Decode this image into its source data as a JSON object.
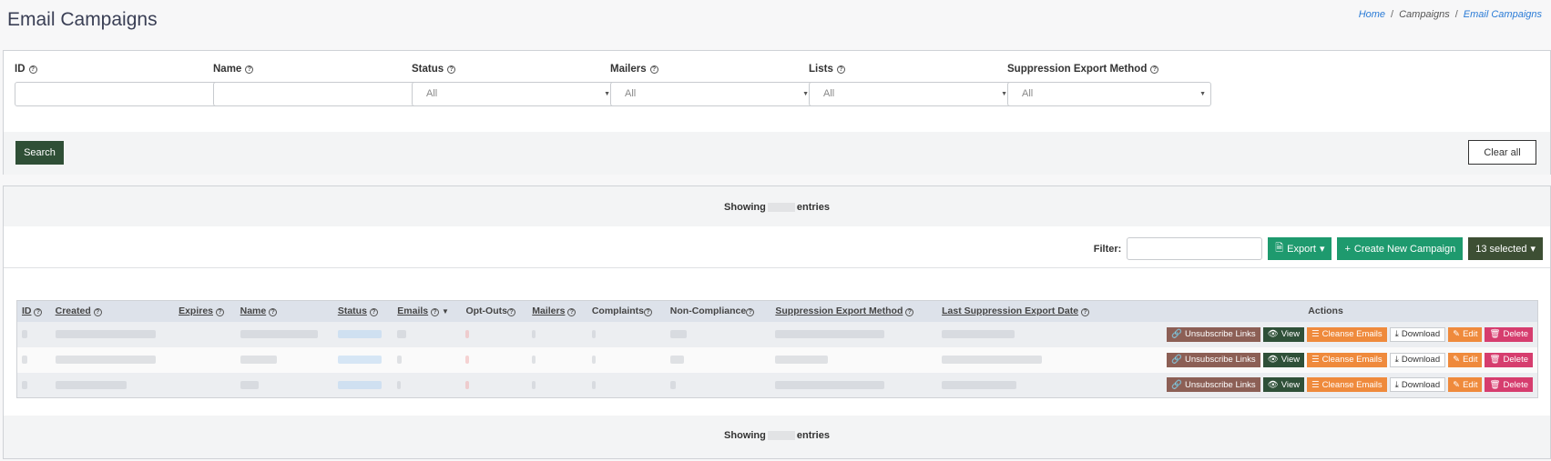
{
  "page": {
    "title": "Email Campaigns"
  },
  "breadcrumb": {
    "home": "Home",
    "campaigns": "Campaigns",
    "current": "Email Campaigns",
    "sep": "/"
  },
  "filters": {
    "id_label": "ID",
    "name_label": "Name",
    "status_label": "Status",
    "mailers_label": "Mailers",
    "lists_label": "Lists",
    "suppression_label": "Suppression Export Method",
    "status_value": "All",
    "mailers_value": "All",
    "lists_value": "All",
    "suppression_value": "All",
    "search_button": "Search",
    "clear_button": "Clear all"
  },
  "list": {
    "showing_prefix": "Showing",
    "showing_suffix": "entries",
    "filter_label": "Filter:",
    "export_button": "Export",
    "create_button": "Create New Campaign",
    "selected_button": "13 selected"
  },
  "table": {
    "headers": {
      "id": "ID",
      "created": "Created",
      "expires": "Expires",
      "name": "Name",
      "status": "Status",
      "emails": "Emails",
      "optouts": "Opt-Outs",
      "mailers": "Mailers",
      "complaints": "Complaints",
      "noncompliance": "Non-Compliance",
      "suppression": "Suppression Export Method",
      "last_suppression": "Last Suppression Export Date",
      "actions": "Actions"
    },
    "actions": {
      "unsub": "Unsubscribe Links",
      "view": "View",
      "cleanse": "Cleanse Emails",
      "download": "Download",
      "edit": "Edit",
      "delete": "Delete"
    }
  },
  "colors": {
    "primary_dark": "#2f4f36",
    "green": "#1e9a6e",
    "orange": "#ef8a3c",
    "danger": "#d63d6e",
    "link": "#2a7bd6"
  }
}
